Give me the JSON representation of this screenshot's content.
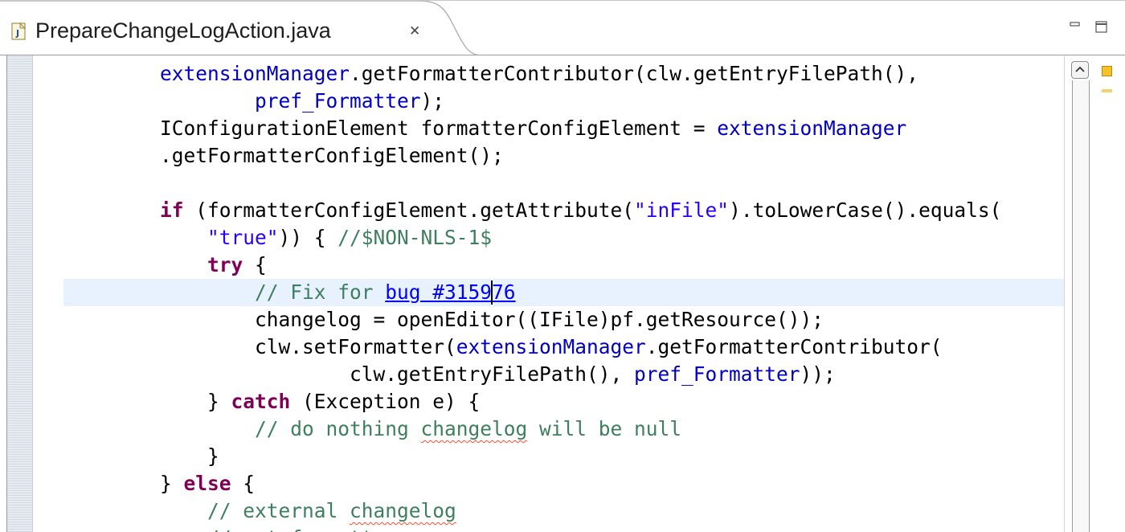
{
  "tab": {
    "title": "PrepareChangeLogAction.java",
    "icon": "java-file-icon",
    "close_glyph": "✕"
  },
  "view_controls": {
    "minimize": "minimize-icon",
    "maximize": "maximize-icon"
  },
  "colors": {
    "keyword": "#7f0055",
    "field": "#0000c0",
    "string": "#2a00ff",
    "comment": "#3f7f5f",
    "link": "#0000ff",
    "current_line": "#e8f2fe",
    "marker": "#f5c22c"
  },
  "code": {
    "lines": [
      [
        {
          "t": "        "
        },
        {
          "t": "extensionManager",
          "c": "fld"
        },
        {
          "t": ".getFormatterContributor(clw.getEntryFilePath(),"
        }
      ],
      [
        {
          "t": "                "
        },
        {
          "t": "pref_Formatter",
          "c": "fld"
        },
        {
          "t": ");"
        }
      ],
      [
        {
          "t": "        IConfigurationElement formatterConfigElement = "
        },
        {
          "t": "extensionManager",
          "c": "fld"
        }
      ],
      [
        {
          "t": "        .getFormatterConfigElement();"
        }
      ],
      [],
      [
        {
          "t": "        "
        },
        {
          "t": "if",
          "c": "kw"
        },
        {
          "t": " (formatterConfigElement.getAttribute("
        },
        {
          "t": "\"inFile\"",
          "c": "str"
        },
        {
          "t": ").toLowerCase().equals("
        }
      ],
      [
        {
          "t": "            "
        },
        {
          "t": "\"true\"",
          "c": "str"
        },
        {
          "t": ")) { "
        },
        {
          "t": "//$NON-NLS-1$",
          "c": "cmt"
        }
      ],
      [
        {
          "t": "            "
        },
        {
          "t": "try",
          "c": "kw"
        },
        {
          "t": " {"
        }
      ],
      [
        {
          "t": "                "
        },
        {
          "t": "// Fix for ",
          "c": "cmt"
        },
        {
          "t": "bug #315976",
          "c": "lnk"
        }
      ],
      [
        {
          "t": "                changelog = openEditor((IFile)pf.getResource());"
        }
      ],
      [
        {
          "t": "                clw.setFormatter("
        },
        {
          "t": "extensionManager",
          "c": "fld"
        },
        {
          "t": ".getFormatterContributor("
        }
      ],
      [
        {
          "t": "                        clw.getEntryFilePath(), "
        },
        {
          "t": "pref_Formatter",
          "c": "fld"
        },
        {
          "t": "));"
        }
      ],
      [
        {
          "t": "            } "
        },
        {
          "t": "catch",
          "c": "kw"
        },
        {
          "t": " (Exception e) {"
        }
      ],
      [
        {
          "t": "                "
        },
        {
          "t": "// do nothing ",
          "c": "cmt"
        },
        {
          "t": "changelog",
          "c": "cmt spell"
        },
        {
          "t": " will be null",
          "c": "cmt"
        }
      ],
      [
        {
          "t": "            }"
        }
      ],
      [
        {
          "t": "        } "
        },
        {
          "t": "else",
          "c": "kw"
        },
        {
          "t": " {"
        }
      ],
      [
        {
          "t": "            "
        },
        {
          "t": "// external ",
          "c": "cmt"
        },
        {
          "t": "changelog",
          "c": "cmt spell"
        }
      ],
      [
        {
          "t": "            "
        },
        {
          "t": "// get formatter",
          "c": "cmt"
        }
      ]
    ]
  }
}
